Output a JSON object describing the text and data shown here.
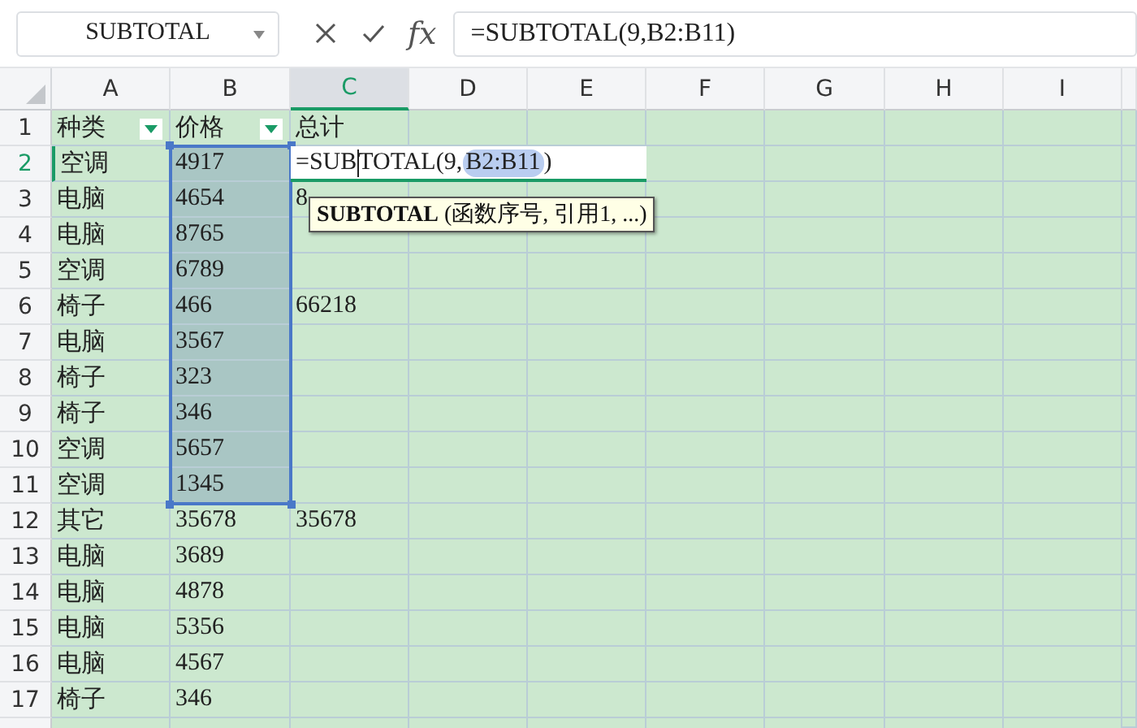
{
  "name_box": {
    "value": "SUBTOTAL"
  },
  "formula_bar": {
    "fx": "fx",
    "value": "=SUBTOTAL(9,B2:B11)"
  },
  "columns": [
    {
      "label": "A",
      "selected": false
    },
    {
      "label": "B",
      "selected": false
    },
    {
      "label": "C",
      "selected": true
    },
    {
      "label": "D",
      "selected": false
    },
    {
      "label": "E",
      "selected": false
    },
    {
      "label": "F",
      "selected": false
    },
    {
      "label": "G",
      "selected": false
    },
    {
      "label": "H",
      "selected": false
    },
    {
      "label": "I",
      "selected": false
    }
  ],
  "rows": [
    {
      "label": "1",
      "selected": false,
      "cells": [
        "种类",
        "价格",
        "总计"
      ],
      "filters": [
        true,
        true,
        false
      ],
      "in_selection": [
        false,
        false,
        false
      ]
    },
    {
      "label": "2",
      "selected": true,
      "cells": [
        "空调",
        "4917"
      ],
      "in_selection": [
        false,
        true,
        false
      ]
    },
    {
      "label": "3",
      "selected": false,
      "cells": [
        "电脑",
        "4654",
        "8"
      ],
      "in_selection": [
        false,
        true,
        false
      ]
    },
    {
      "label": "4",
      "selected": false,
      "cells": [
        "电脑",
        "8765"
      ],
      "in_selection": [
        false,
        true,
        false
      ]
    },
    {
      "label": "5",
      "selected": false,
      "cells": [
        "空调",
        "6789"
      ],
      "in_selection": [
        false,
        true,
        false
      ]
    },
    {
      "label": "6",
      "selected": false,
      "cells": [
        "椅子",
        "466",
        "66218"
      ],
      "in_selection": [
        false,
        true,
        false
      ]
    },
    {
      "label": "7",
      "selected": false,
      "cells": [
        "电脑",
        "3567"
      ],
      "in_selection": [
        false,
        true,
        false
      ]
    },
    {
      "label": "8",
      "selected": false,
      "cells": [
        "椅子",
        "323"
      ],
      "in_selection": [
        false,
        true,
        false
      ]
    },
    {
      "label": "9",
      "selected": false,
      "cells": [
        "椅子",
        "346"
      ],
      "in_selection": [
        false,
        true,
        false
      ]
    },
    {
      "label": "10",
      "selected": false,
      "cells": [
        "空调",
        "5657"
      ],
      "in_selection": [
        false,
        true,
        false
      ]
    },
    {
      "label": "11",
      "selected": false,
      "cells": [
        "空调",
        "1345"
      ],
      "in_selection": [
        false,
        true,
        false
      ]
    },
    {
      "label": "12",
      "selected": false,
      "cells": [
        "其它",
        "35678",
        "35678"
      ],
      "in_selection": [
        false,
        false,
        false
      ]
    },
    {
      "label": "13",
      "selected": false,
      "cells": [
        "电脑",
        "3689"
      ],
      "in_selection": [
        false,
        false,
        false
      ]
    },
    {
      "label": "14",
      "selected": false,
      "cells": [
        "电脑",
        "4878"
      ],
      "in_selection": [
        false,
        false,
        false
      ]
    },
    {
      "label": "15",
      "selected": false,
      "cells": [
        "电脑",
        "5356"
      ],
      "in_selection": [
        false,
        false,
        false
      ]
    },
    {
      "label": "16",
      "selected": false,
      "cells": [
        "电脑",
        "4567"
      ],
      "in_selection": [
        false,
        false,
        false
      ]
    },
    {
      "label": "17",
      "selected": false,
      "cells": [
        "椅子",
        "346"
      ],
      "in_selection": [
        false,
        false,
        false
      ]
    }
  ],
  "editor": {
    "before_cursor": "=SUB",
    "after_cursor": "TOTAL(9, ",
    "reference": "B2:B11",
    "closing": ")"
  },
  "tooltip": {
    "text": "**SUBTOTAL** (函数序号, 引用1, ...)"
  }
}
